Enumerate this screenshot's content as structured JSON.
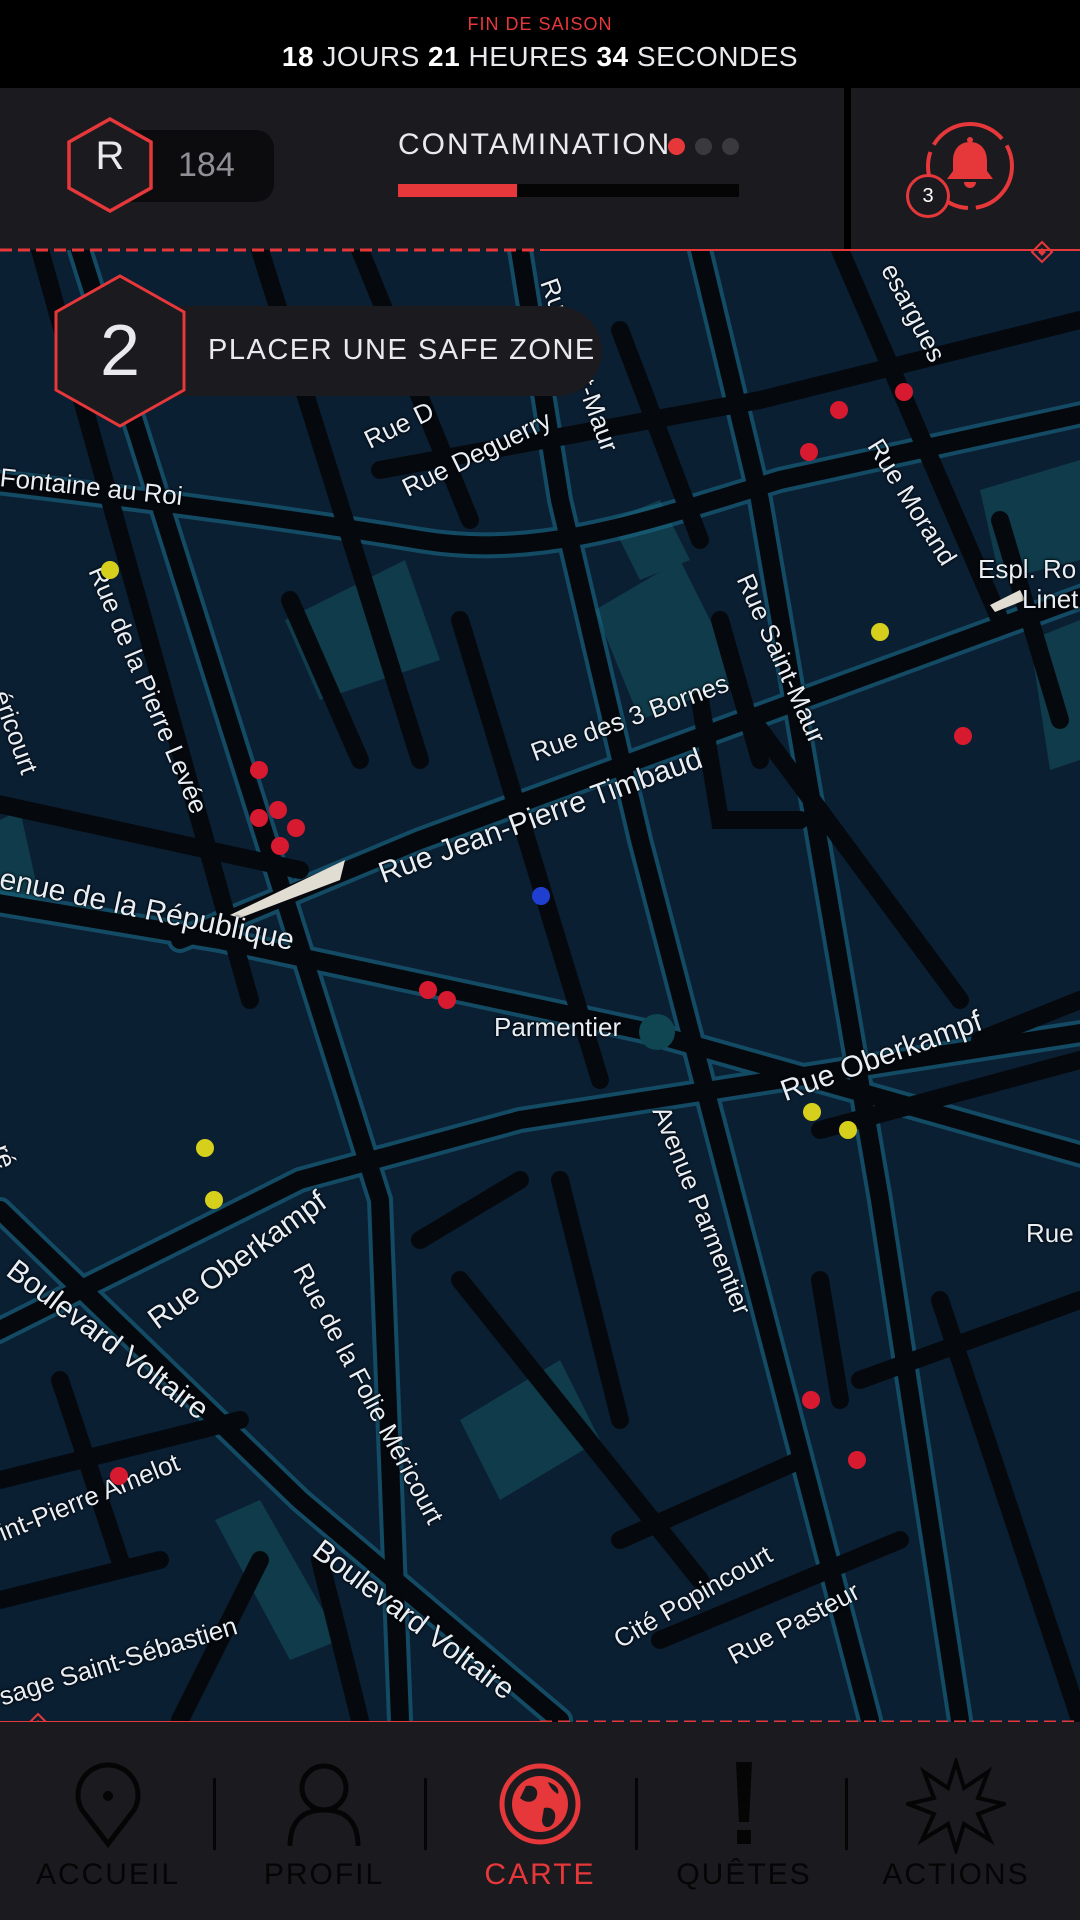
{
  "season": {
    "label": "FIN DE SAISON",
    "days": "18",
    "days_unit": "JOURS",
    "hours": "21",
    "hours_unit": "HEURES",
    "seconds": "34",
    "seconds_unit": "SECONDES"
  },
  "rank": {
    "letter": "R",
    "points": "184"
  },
  "contamination": {
    "label": "CONTAMINATION",
    "level": 1,
    "max_level": 3,
    "progress_fraction": 0.35
  },
  "notifications": {
    "count": "3",
    "icon": "bell-icon"
  },
  "quest": {
    "number": "2",
    "label": "PLACER UNE SAFE ZONE"
  },
  "map": {
    "streets": [
      "Rue Saint-Maur",
      "esargues",
      "Rue Morand",
      "Rue Deguerry",
      "Rue D",
      "Fontaine au Roi",
      "Rue de la Pierre Levée",
      "éricourt",
      "Espl. Ro",
      "Linet",
      "Rue des 3 Bornes",
      "Rue Jean-Pierre Timbaud",
      "Rue Saint-Maur",
      "enue de la République",
      "Parmentier",
      "Rue Oberkampf",
      "Avenue Parmentier",
      "Rue Oberkampf",
      "Boulevard Voltaire",
      "Rue de la Folie Méricourt",
      "Rue",
      "int-Pierre Amelot",
      "Boulevard Voltaire",
      "Cité Popincourt",
      "Rue Pasteur",
      "sage Saint-Sébastien",
      "ré"
    ],
    "marker_colors": {
      "red": "#d71a2f",
      "yellow": "#d6d01c",
      "blue": "#1f3fd0"
    }
  },
  "nav": {
    "items": [
      {
        "label": "ACCUEIL",
        "icon": "map-pin-icon",
        "active": false
      },
      {
        "label": "PROFIL",
        "icon": "user-icon",
        "active": false
      },
      {
        "label": "CARTE",
        "icon": "globe-icon",
        "active": true
      },
      {
        "label": "QUÊTES",
        "icon": "exclamation-icon",
        "active": false
      },
      {
        "label": "ACTIONS",
        "icon": "explosion-icon",
        "active": false
      }
    ]
  },
  "colors": {
    "accent": "#e6373a",
    "panel": "#1b1b1f",
    "map_bg": "#0b1f33"
  }
}
